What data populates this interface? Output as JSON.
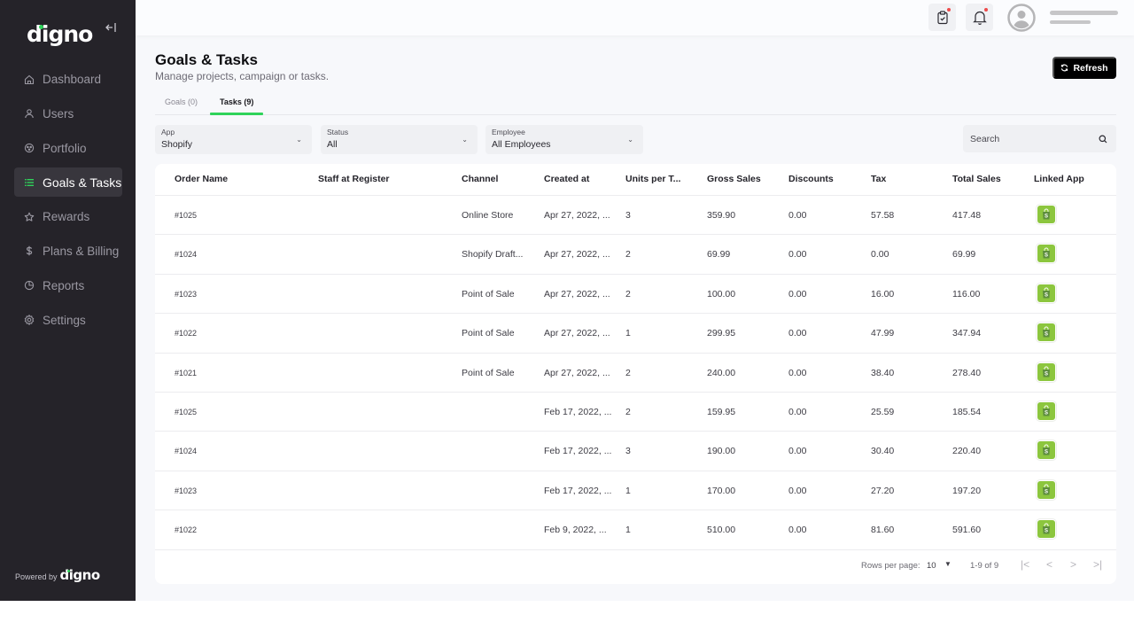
{
  "brand": {
    "name": "digno",
    "accent": "#2fd35a"
  },
  "sidebar": {
    "collapse_icon": "collapse-left-icon",
    "items": [
      {
        "label": "Dashboard",
        "icon": "home-icon",
        "active": false
      },
      {
        "label": "Users",
        "icon": "user-icon",
        "active": false
      },
      {
        "label": "Portfolio",
        "icon": "portfolio-icon",
        "active": false
      },
      {
        "label": "Goals & Tasks",
        "icon": "list-icon",
        "active": true
      },
      {
        "label": "Rewards",
        "icon": "star-icon",
        "active": false
      },
      {
        "label": "Plans & Billing",
        "icon": "dollar-icon",
        "active": false
      },
      {
        "label": "Reports",
        "icon": "pie-chart-icon",
        "active": false
      },
      {
        "label": "Settings",
        "icon": "gear-icon",
        "active": false
      }
    ],
    "powered_by": "Powered by",
    "powered_brand": "digno"
  },
  "topbar": {
    "tasks_icon": "clipboard-check-icon",
    "notifications_icon": "bell-icon",
    "avatar_icon": "user-avatar-icon"
  },
  "page": {
    "title": "Goals & Tasks",
    "subtitle": "Manage projects, campaign or tasks.",
    "refresh_label": "Refresh"
  },
  "tabs": [
    {
      "label": "Goals (0)",
      "active": false
    },
    {
      "label": "Tasks (9)",
      "active": true
    }
  ],
  "filters": {
    "app": {
      "label": "App",
      "value": "Shopify"
    },
    "status": {
      "label": "Status",
      "value": "All"
    },
    "employee": {
      "label": "Employee",
      "value": "All Employees"
    },
    "search_placeholder": "Search"
  },
  "table": {
    "columns": [
      "Order Name",
      "Staff at Register",
      "Channel",
      "Created at",
      "Units per T...",
      "Gross Sales",
      "Discounts",
      "Tax",
      "Total Sales",
      "Linked App"
    ],
    "rows": [
      {
        "order": "#1025",
        "staff": "",
        "channel": "Online Store",
        "created": "Apr 27, 2022, ...",
        "units": "3",
        "gross": "359.90",
        "discounts": "0.00",
        "tax": "57.58",
        "total": "417.48",
        "app": "Shopify"
      },
      {
        "order": "#1024",
        "staff": "",
        "channel": "Shopify Draft...",
        "created": "Apr 27, 2022, ...",
        "units": "2",
        "gross": "69.99",
        "discounts": "0.00",
        "tax": "0.00",
        "total": "69.99",
        "app": "Shopify"
      },
      {
        "order": "#1023",
        "staff": "",
        "channel": "Point of Sale",
        "created": "Apr 27, 2022, ...",
        "units": "2",
        "gross": "100.00",
        "discounts": "0.00",
        "tax": "16.00",
        "total": "116.00",
        "app": "Shopify"
      },
      {
        "order": "#1022",
        "staff": "",
        "channel": "Point of Sale",
        "created": "Apr 27, 2022, ...",
        "units": "1",
        "gross": "299.95",
        "discounts": "0.00",
        "tax": "47.99",
        "total": "347.94",
        "app": "Shopify"
      },
      {
        "order": "#1021",
        "staff": "",
        "channel": "Point of Sale",
        "created": "Apr 27, 2022, ...",
        "units": "2",
        "gross": "240.00",
        "discounts": "0.00",
        "tax": "38.40",
        "total": "278.40",
        "app": "Shopify"
      },
      {
        "order": "#1025",
        "staff": "",
        "channel": "",
        "created": "Feb 17, 2022, ...",
        "units": "2",
        "gross": "159.95",
        "discounts": "0.00",
        "tax": "25.59",
        "total": "185.54",
        "app": "Shopify"
      },
      {
        "order": "#1024",
        "staff": "",
        "channel": "",
        "created": "Feb 17, 2022, ...",
        "units": "3",
        "gross": "190.00",
        "discounts": "0.00",
        "tax": "30.40",
        "total": "220.40",
        "app": "Shopify"
      },
      {
        "order": "#1023",
        "staff": "",
        "channel": "",
        "created": "Feb 17, 2022, ...",
        "units": "1",
        "gross": "170.00",
        "discounts": "0.00",
        "tax": "27.20",
        "total": "197.20",
        "app": "Shopify"
      },
      {
        "order": "#1022",
        "staff": "",
        "channel": "",
        "created": "Feb 9, 2022, ...",
        "units": "1",
        "gross": "510.00",
        "discounts": "0.00",
        "tax": "81.60",
        "total": "591.60",
        "app": "Shopify"
      }
    ]
  },
  "pagination": {
    "rows_per_page_label": "Rows per page:",
    "rows_per_page": "10",
    "range": "1-9 of 9",
    "first_icon": "|<",
    "prev_icon": "<",
    "next_icon": ">",
    "last_icon": ">|"
  }
}
